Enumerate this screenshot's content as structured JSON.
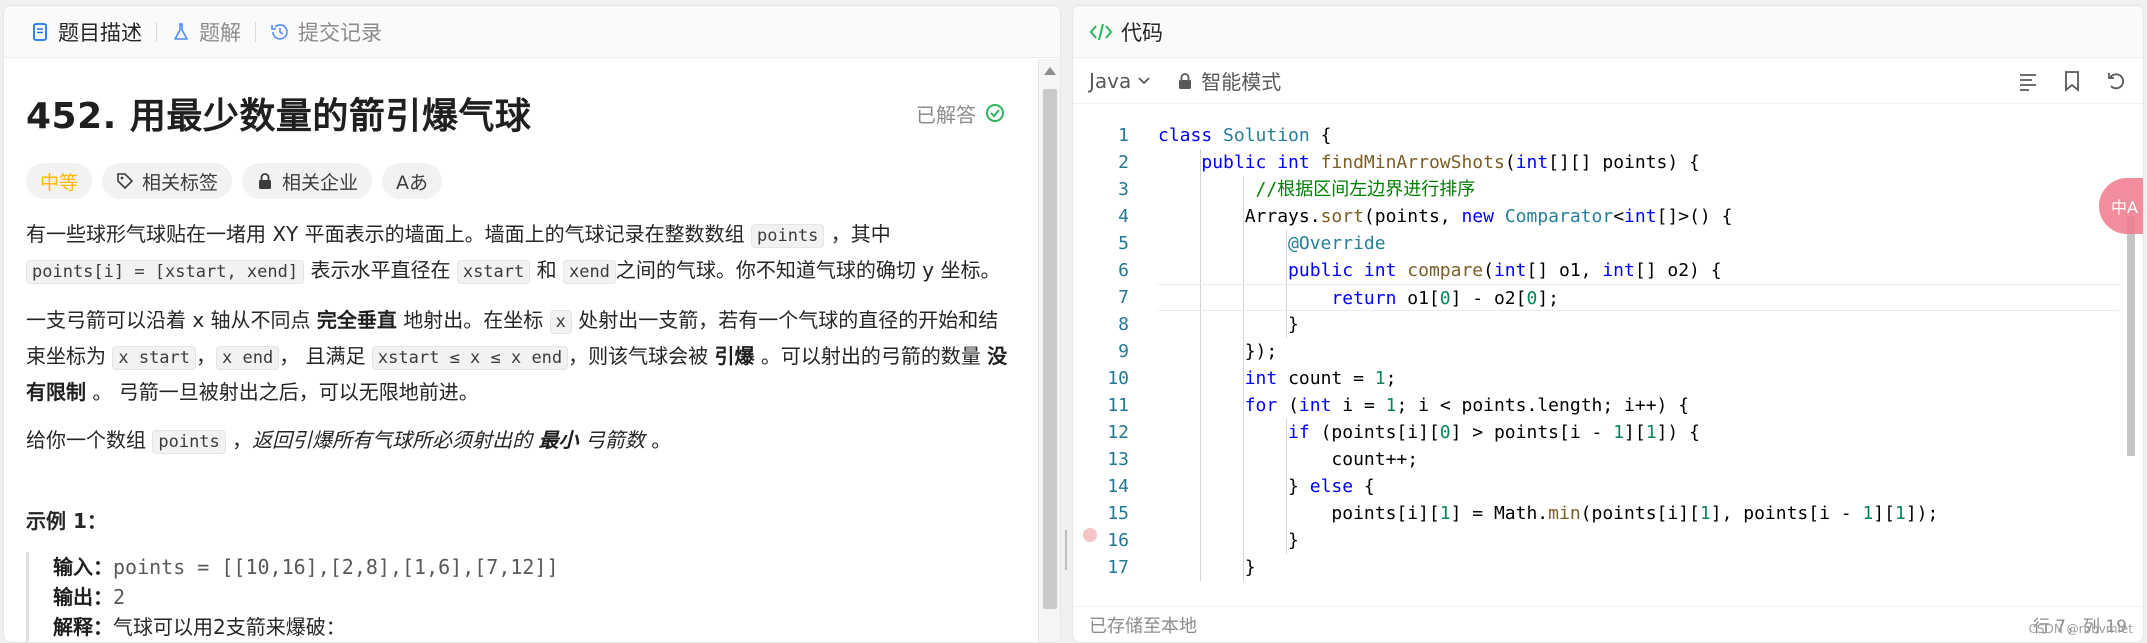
{
  "left_tabs": [
    {
      "label": "题目描述",
      "active": true
    },
    {
      "label": "题解",
      "active": false
    },
    {
      "label": "提交记录",
      "active": false
    }
  ],
  "problem": {
    "title": "452. 用最少数量的箭引爆气球",
    "status": "已解答",
    "tags": {
      "difficulty": "中等",
      "related_tags": "相关标签",
      "related_companies": "相关企业",
      "font_toggle": "Aあ"
    },
    "p1": {
      "t1": "有一些球形气球贴在一堵用 XY 平面表示的墙面上。墙面上的气球记录在整数数组 ",
      "c1": "points",
      "t2": " ，其中",
      "c2": "points[i] = [xstart, xend]",
      "t3": " 表示水平直径在 ",
      "c3": "xstart",
      "t4": " 和 ",
      "c4": "xend",
      "t5": "之间的气球。你不知道气球的确切 y 坐标。"
    },
    "p2": {
      "t1": "一支弓箭可以沿着 x 轴从不同点 ",
      "b1": "完全垂直",
      "t2": " 地射出。在坐标 ",
      "c1": "x",
      "t3": " 处射出一支箭，若有一个气球的直径的开始和结束坐标为 ",
      "c2": "x start",
      "t4": "，",
      "c3": "x end",
      "t5": "， 且满足  ",
      "c4": "xstart ≤ x ≤ x end",
      "t6": "，则该气球会被 ",
      "b2": "引爆",
      "t7": " 。可以射出的弓箭的数量 ",
      "b3": "没有限制",
      "t8": " 。 弓箭一旦被射出之后，可以无限地前进。"
    },
    "p3": {
      "t1": "给你一个数组 ",
      "c1": "points",
      "t2": " ，",
      "i1": "返回引爆所有气球所必须射出的 ",
      "b1": "最小",
      "i2": " 弓箭数",
      "t3": " 。"
    },
    "example": {
      "title": "示例 1：",
      "input_label": "输入：",
      "input_value": "points = [[10,16],[2,8],[1,6],[7,12]]",
      "output_label": "输出：",
      "output_value": "2",
      "explain_label": "解释：",
      "explain_value": "气球可以用2支箭来爆破："
    }
  },
  "editor": {
    "header": "代码",
    "language": "Java",
    "mode": "智能模式",
    "status_left": "已存储至本地",
    "status_right": "行 7，列 19",
    "watermark": "CSDN @rbbvmlet",
    "float_button": "中A",
    "line_numbers": [
      "1",
      "2",
      "3",
      "4",
      "5",
      "6",
      "7",
      "8",
      "9",
      "10",
      "11",
      "12",
      "13",
      "14",
      "15",
      "16",
      "17"
    ],
    "code": {
      "l1a": "class ",
      "l1b": "Solution",
      "l1c": " {",
      "l2a": "public int ",
      "l2b": "findMinArrowShots",
      "l2c": "(",
      "l2d": "int",
      "l2e": "[][] points) {",
      "l3": "//根据区间左边界进行排序",
      "l4a": "Arrays.",
      "l4b": "sort",
      "l4c": "(points, ",
      "l4d": "new ",
      "l4e": "Comparator",
      "l4f": "<",
      "l4g": "int",
      "l4h": "[]>() {",
      "l5": "@Override",
      "l6a": "public int ",
      "l6b": "compare",
      "l6c": "(",
      "l6d": "int",
      "l6e": "[] o1, ",
      "l6f": "int",
      "l6g": "[] o2) {",
      "l7a": "return ",
      "l7b": "o1[",
      "l7c": "0",
      "l7d": "] - o2[",
      "l7e": "0",
      "l7f": "];",
      "l8": "}",
      "l9": "});",
      "l10a": "int ",
      "l10b": "count = ",
      "l10c": "1",
      "l10d": ";",
      "l11a": "for ",
      "l11b": "(",
      "l11c": "int ",
      "l11d": "i = ",
      "l11e": "1",
      "l11f": "; i < points.length; i++) {",
      "l12a": "if ",
      "l12b": "(points[i][",
      "l12c": "0",
      "l12d": "] > points[i - ",
      "l12e": "1",
      "l12f": "][",
      "l12g": "1",
      "l12h": "]) {",
      "l13": "count++;",
      "l14a": "} ",
      "l14b": "else ",
      "l14c": "{",
      "l15a": "points[i][",
      "l15b": "1",
      "l15c": "] = Math.",
      "l15d": "min",
      "l15e": "(points[i][",
      "l15f": "1",
      "l15g": "], points[i - ",
      "l15h": "1",
      "l15i": "][",
      "l15j": "1",
      "l15k": "]);",
      "l16": "}",
      "l17": "}"
    }
  },
  "colors": {
    "difficulty": "#ffb800",
    "solved_check": "#2db55d",
    "code_header_icon": "#2db55d",
    "keyword": "#0000ff",
    "comment": "#008000"
  }
}
